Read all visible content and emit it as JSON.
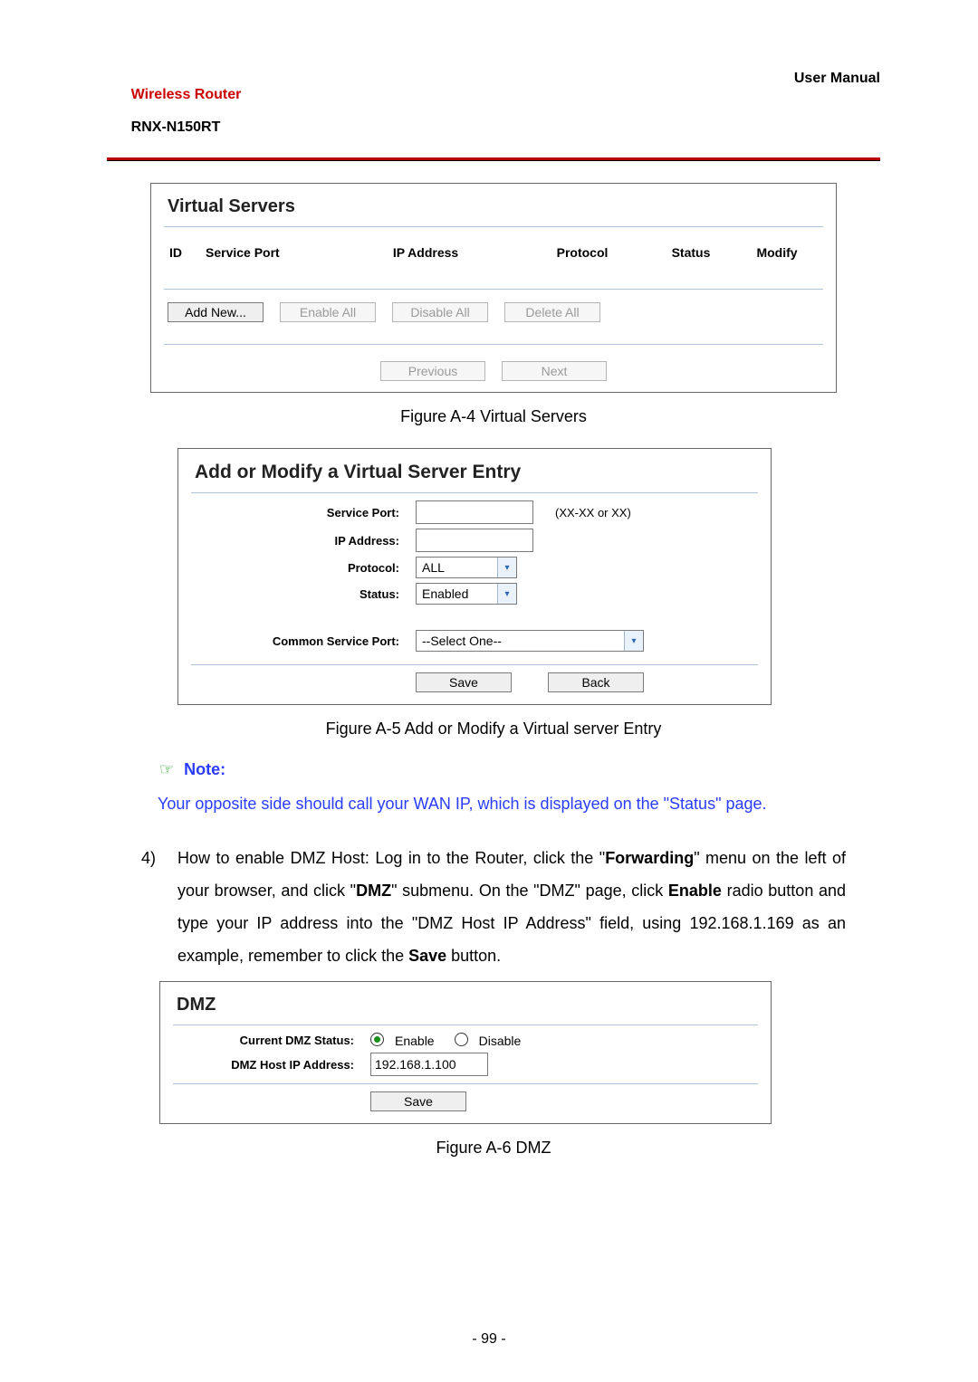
{
  "header": {
    "brand": "Wireless Router",
    "model": "RNX-N150RT",
    "right": "User Manual"
  },
  "fig_a4": {
    "title": "Virtual Servers",
    "cols": [
      "ID",
      "Service Port",
      "IP Address",
      "Protocol",
      "Status",
      "Modify"
    ],
    "buttons": {
      "add": "Add New...",
      "enable": "Enable All",
      "disable": "Disable All",
      "delete": "Delete All"
    },
    "pager": {
      "prev": "Previous",
      "next": "Next"
    },
    "caption": "Figure A-4    Virtual Servers"
  },
  "fig_a5": {
    "title": "Add or Modify a Virtual Server Entry",
    "labels": {
      "svcport": "Service Port:",
      "ip": "IP Address:",
      "proto": "Protocol:",
      "status": "Status:",
      "common": "Common Service Port:"
    },
    "values": {
      "svcport": "",
      "svcport_hint": "(XX-XX or XX)",
      "ip": "",
      "proto": "ALL",
      "status": "Enabled",
      "common": "--Select One--"
    },
    "buttons": {
      "save": "Save",
      "back": "Back"
    },
    "caption": "Figure A-5    Add or Modify a Virtual server Entry"
  },
  "note": {
    "hand": "☞",
    "label": "Note:",
    "body": "Your opposite side should call your WAN IP, which is displayed on the \"Status\" page."
  },
  "step4": {
    "num": "4)",
    "t1": "How to enable DMZ Host: Log in to the Router, click the \"",
    "b1": "Forwarding",
    "t2": "\" menu on the left of your browser, and click \"",
    "b2": "DMZ",
    "t3": "\" submenu. On the \"DMZ\" page, click ",
    "b3": "Enable",
    "t4": " radio button and type your IP address into the \"DMZ Host IP Address\" field, using 192.168.1.169 as an example, remember to click the ",
    "b4": "Save",
    "t5": " button."
  },
  "fig_a6": {
    "title": "DMZ",
    "labels": {
      "cur": "Current DMZ Status:",
      "host": "DMZ Host IP Address:"
    },
    "values": {
      "enable": "Enable",
      "disable": "Disable",
      "host": "192.168.1.100"
    },
    "buttons": {
      "save": "Save"
    },
    "caption": "Figure A-6    DMZ"
  },
  "pagenum": "- 99 -"
}
